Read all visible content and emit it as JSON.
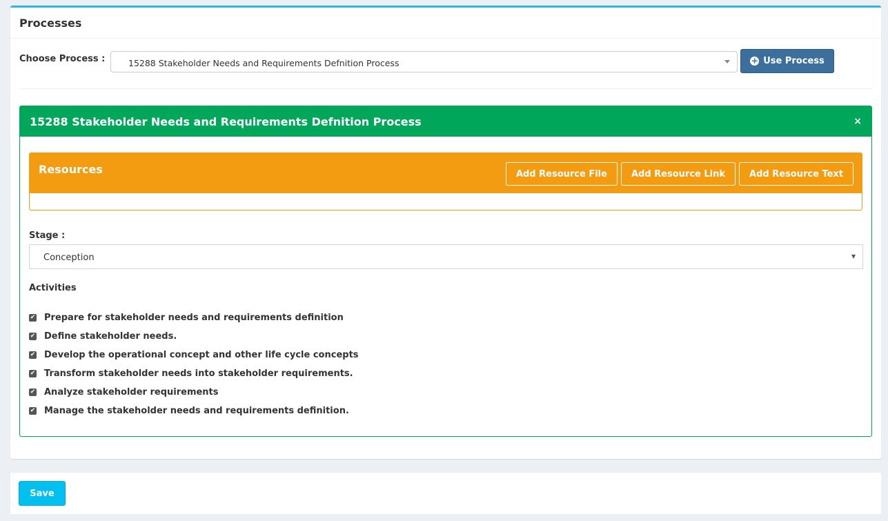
{
  "processes": {
    "title": "Processes",
    "choose_label": "Choose Process :",
    "selected_process": "15288 Stakeholder Needs and Requirements Defnition Process",
    "use_button": "Use Process"
  },
  "process_panel": {
    "title": "15288 Stakeholder Needs and Requirements Defnition Process",
    "close_icon": "×"
  },
  "resources": {
    "title": "Resources",
    "buttons": [
      "Add Resource File",
      "Add Resource Link",
      "Add Resource Text"
    ]
  },
  "stage": {
    "label": "Stage :",
    "value": "Conception"
  },
  "activities": {
    "label": "Activities",
    "items": [
      "Prepare for stakeholder needs and requirements definition",
      "Define stakeholder needs.",
      "Develop the operational concept and other life cycle concepts",
      "Transform stakeholder needs into stakeholder requirements.",
      "Analyze stakeholder requirements",
      "Manage the stakeholder needs and requirements definition."
    ]
  },
  "footer": {
    "save_label": "Save"
  },
  "colors": {
    "primary_button": "#3c6f9c",
    "success": "#00a65a",
    "warning": "#f39c12",
    "info": "#00c0ef",
    "top_border": "#2cb6e0"
  }
}
